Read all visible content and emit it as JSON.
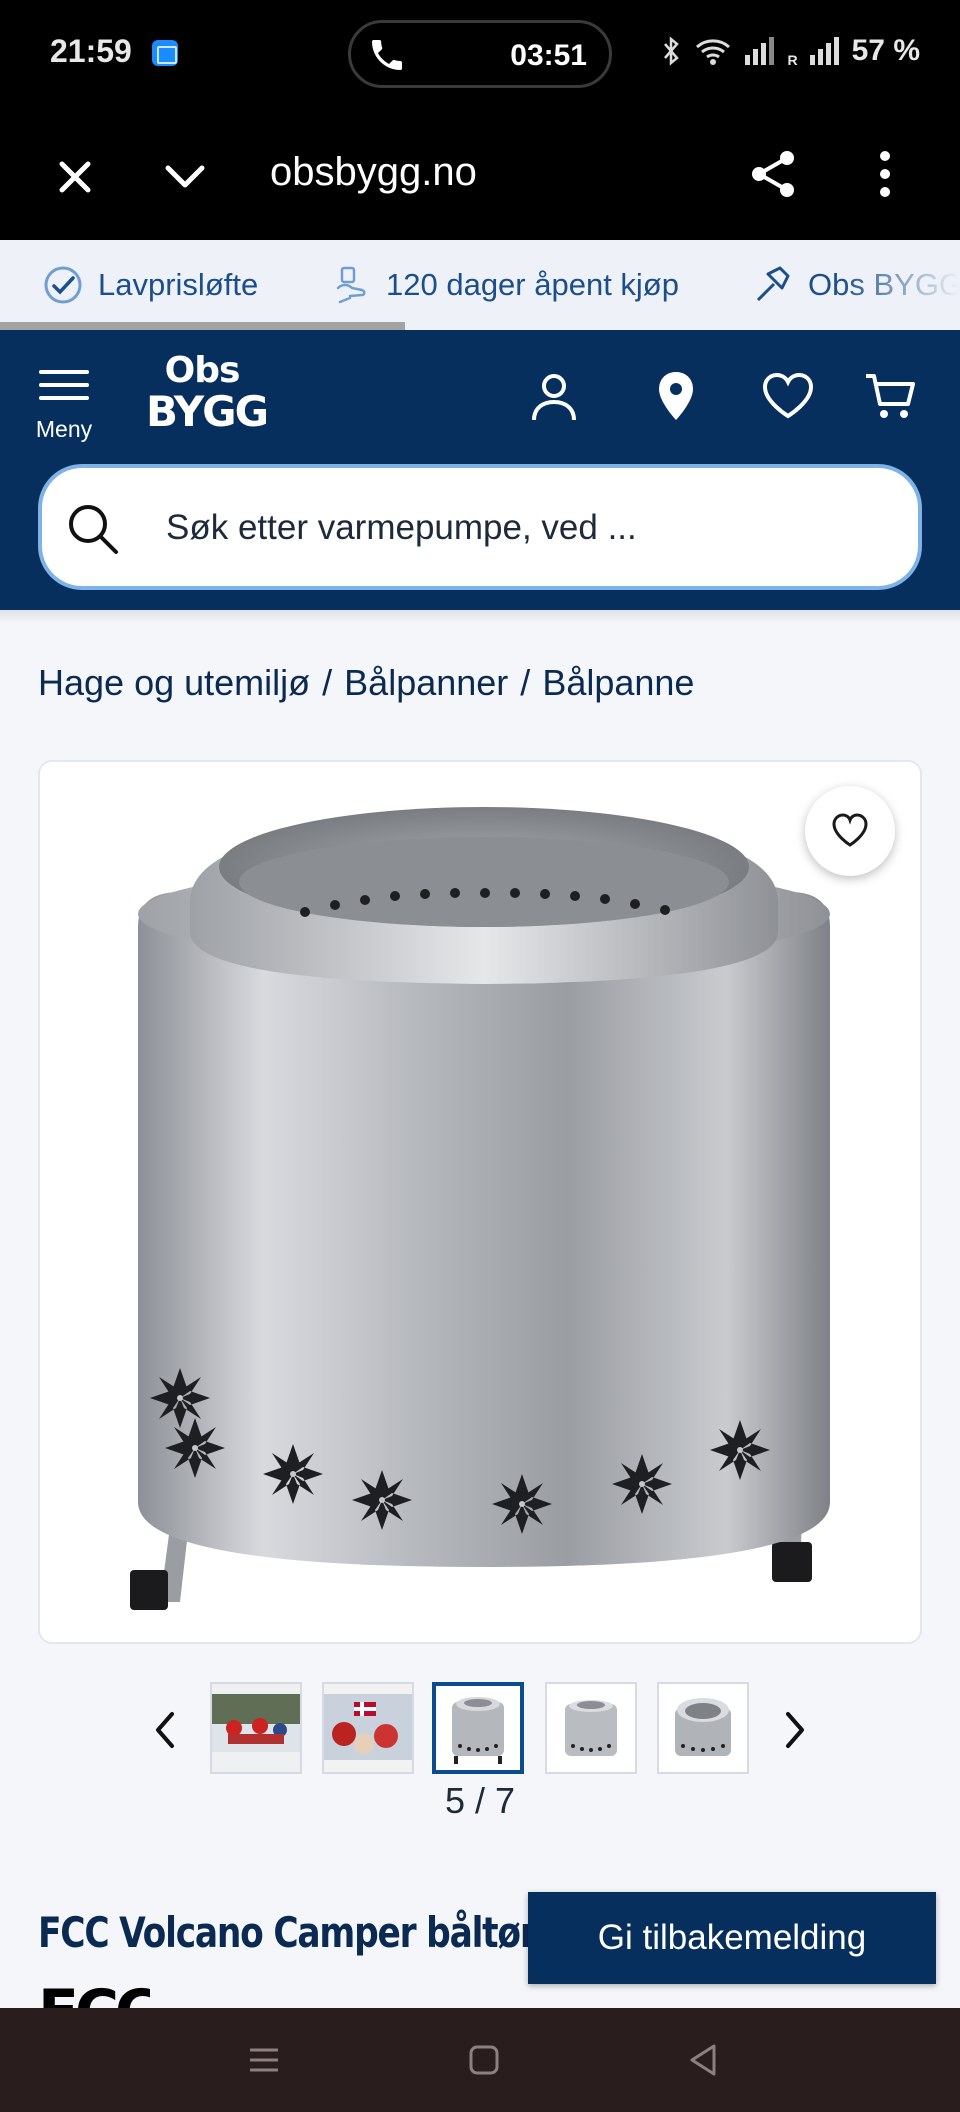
{
  "status_bar": {
    "time": "21:59",
    "call_duration": "03:51",
    "battery": "57 %",
    "network_label": "R",
    "icons": [
      "app-badge-icon",
      "phone-icon",
      "bluetooth-icon",
      "wifi-icon",
      "signal-icon",
      "signal-roaming-icon"
    ]
  },
  "browser": {
    "url": "obsbygg.no",
    "icons": [
      "close-icon",
      "chevron-down-icon",
      "share-icon",
      "more-vertical-icon"
    ]
  },
  "usp_ribbon": {
    "items": [
      {
        "label": "Lavprisløfte",
        "icon": "check-circle-icon"
      },
      {
        "label": "120 dager åpent kjøp",
        "icon": "hand-bag-icon"
      },
      {
        "label": "Obs BYGG",
        "icon": "hammer-icon"
      }
    ]
  },
  "header": {
    "menu_label": "Meny",
    "logo_top": "Obs",
    "logo_bottom": "BYGG",
    "icons": [
      "user-icon",
      "location-pin-icon",
      "heart-icon",
      "cart-icon"
    ],
    "search_placeholder": "Søk etter varmepumpe, ved ..."
  },
  "breadcrumb": {
    "items": [
      "Hage og utemiljø",
      "Bålpanner",
      "Bålpanne"
    ],
    "separator": "/"
  },
  "gallery": {
    "current": "5",
    "total": "7",
    "counter_sep": " / ",
    "thumbnails": [
      {
        "name": "thumb-outdoor-group",
        "active": false
      },
      {
        "name": "thumb-flags",
        "active": false
      },
      {
        "name": "thumb-firepit-front",
        "active": true
      },
      {
        "name": "thumb-firepit-side",
        "active": false
      },
      {
        "name": "thumb-firepit-top",
        "active": false
      }
    ]
  },
  "product": {
    "title": "FCC Volcano Camper båltønne",
    "brand": "FCC"
  },
  "feedback_button": "Gi tilbakemelding",
  "colors": {
    "brand_navy": "#062f5e",
    "link_blue": "#1c4f8a",
    "search_border": "#7fb2e6",
    "active_thumb": "#0b4c8c"
  }
}
